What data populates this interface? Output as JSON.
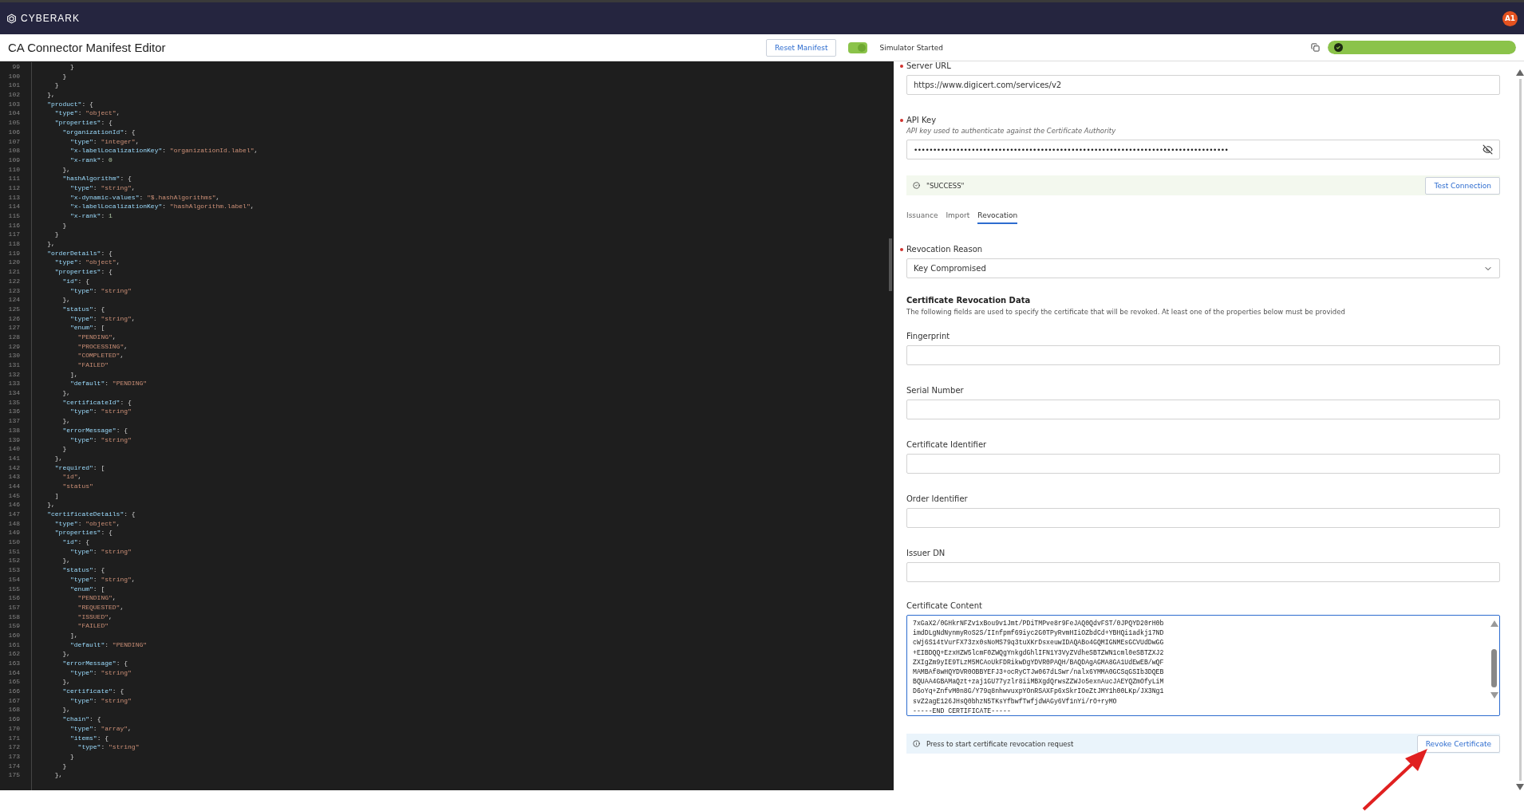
{
  "top_bar": {
    "brand": "CYBERARK",
    "avatar": "A1"
  },
  "header": {
    "title": "CA Connector Manifest Editor",
    "reset_button": "Reset Manifest",
    "simulator": {
      "on": true,
      "label": "Simulator Started"
    },
    "status_bar": {
      "level": 1
    }
  },
  "editor": {
    "lines": [
      {
        "num": "99",
        "text": "          }"
      },
      {
        "num": "100",
        "text": "        }"
      },
      {
        "num": "101",
        "text": "      }"
      },
      {
        "num": "102",
        "text": "    },"
      },
      {
        "num": "103",
        "text": "    \"product\": {"
      },
      {
        "num": "104",
        "text": "      \"type\": \"object\","
      },
      {
        "num": "105",
        "text": "      \"properties\": {"
      },
      {
        "num": "106",
        "text": "        \"organizationId\": {"
      },
      {
        "num": "107",
        "text": "          \"type\": \"integer\","
      },
      {
        "num": "108",
        "text": "          \"x-labelLocalizationKey\": \"organizationId.label\","
      },
      {
        "num": "109",
        "text": "          \"x-rank\": 0"
      },
      {
        "num": "110",
        "text": "        },"
      },
      {
        "num": "111",
        "text": "        \"hashAlgorithm\": {"
      },
      {
        "num": "112",
        "text": "          \"type\": \"string\","
      },
      {
        "num": "113",
        "text": "          \"x-dynamic-values\": \"$.hashAlgorithms\","
      },
      {
        "num": "114",
        "text": "          \"x-labelLocalizationKey\": \"hashAlgorithm.label\","
      },
      {
        "num": "115",
        "text": "          \"x-rank\": 1"
      },
      {
        "num": "116",
        "text": "        }"
      },
      {
        "num": "117",
        "text": "      }"
      },
      {
        "num": "118",
        "text": "    },"
      },
      {
        "num": "119",
        "text": "    \"orderDetails\": {"
      },
      {
        "num": "120",
        "text": "      \"type\": \"object\","
      },
      {
        "num": "121",
        "text": "      \"properties\": {"
      },
      {
        "num": "122",
        "text": "        \"id\": {"
      },
      {
        "num": "123",
        "text": "          \"type\": \"string\""
      },
      {
        "num": "124",
        "text": "        },"
      },
      {
        "num": "125",
        "text": "        \"status\": {"
      },
      {
        "num": "126",
        "text": "          \"type\": \"string\","
      },
      {
        "num": "127",
        "text": "          \"enum\": ["
      },
      {
        "num": "128",
        "text": "            \"PENDING\","
      },
      {
        "num": "129",
        "text": "            \"PROCESSING\","
      },
      {
        "num": "130",
        "text": "            \"COMPLETED\","
      },
      {
        "num": "131",
        "text": "            \"FAILED\""
      },
      {
        "num": "132",
        "text": "          ],"
      },
      {
        "num": "133",
        "text": "          \"default\": \"PENDING\""
      },
      {
        "num": "134",
        "text": "        },"
      },
      {
        "num": "135",
        "text": "        \"certificateId\": {"
      },
      {
        "num": "136",
        "text": "          \"type\": \"string\""
      },
      {
        "num": "137",
        "text": "        },"
      },
      {
        "num": "138",
        "text": "        \"errorMessage\": {"
      },
      {
        "num": "139",
        "text": "          \"type\": \"string\""
      },
      {
        "num": "140",
        "text": "        }"
      },
      {
        "num": "141",
        "text": "      },"
      },
      {
        "num": "142",
        "text": "      \"required\": ["
      },
      {
        "num": "143",
        "text": "        \"id\","
      },
      {
        "num": "144",
        "text": "        \"status\""
      },
      {
        "num": "145",
        "text": "      ]"
      },
      {
        "num": "146",
        "text": "    },"
      },
      {
        "num": "147",
        "text": "    \"certificateDetails\": {"
      },
      {
        "num": "148",
        "text": "      \"type\": \"object\","
      },
      {
        "num": "149",
        "text": "      \"properties\": {"
      },
      {
        "num": "150",
        "text": "        \"id\": {"
      },
      {
        "num": "151",
        "text": "          \"type\": \"string\""
      },
      {
        "num": "152",
        "text": "        },"
      },
      {
        "num": "153",
        "text": "        \"status\": {"
      },
      {
        "num": "154",
        "text": "          \"type\": \"string\","
      },
      {
        "num": "155",
        "text": "          \"enum\": ["
      },
      {
        "num": "156",
        "text": "            \"PENDING\","
      },
      {
        "num": "157",
        "text": "            \"REQUESTED\","
      },
      {
        "num": "158",
        "text": "            \"ISSUED\","
      },
      {
        "num": "159",
        "text": "            \"FAILED\""
      },
      {
        "num": "160",
        "text": "          ],"
      },
      {
        "num": "161",
        "text": "          \"default\": \"PENDING\""
      },
      {
        "num": "162",
        "text": "        },"
      },
      {
        "num": "163",
        "text": "        \"errorMessage\": {"
      },
      {
        "num": "164",
        "text": "          \"type\": \"string\""
      },
      {
        "num": "165",
        "text": "        },"
      },
      {
        "num": "166",
        "text": "        \"certificate\": {"
      },
      {
        "num": "167",
        "text": "          \"type\": \"string\""
      },
      {
        "num": "168",
        "text": "        },"
      },
      {
        "num": "169",
        "text": "        \"chain\": {"
      },
      {
        "num": "170",
        "text": "          \"type\": \"array\","
      },
      {
        "num": "171",
        "text": "          \"items\": {"
      },
      {
        "num": "172",
        "text": "            \"type\": \"string\""
      },
      {
        "num": "173",
        "text": "          }"
      },
      {
        "num": "174",
        "text": "        }"
      },
      {
        "num": "175",
        "text": "      },"
      }
    ]
  },
  "form": {
    "server_url": {
      "label": "Server URL",
      "required": true,
      "value": "https://www.digicert.com/services/v2"
    },
    "api_key": {
      "label": "API Key",
      "required": true,
      "hint": "API key used to authenticate against the Certificate Authority",
      "value": "••••••••••••••••••••••••••••••••••••••••••••••••••••••••••••••••••••••••••••••••••"
    },
    "connection": {
      "message": "\"SUCCESS\"",
      "button": "Test Connection"
    },
    "tabs": [
      {
        "label": "Issuance",
        "selected": false
      },
      {
        "label": "Import",
        "selected": false
      },
      {
        "label": "Revocation",
        "selected": true
      }
    ],
    "revocation_reason": {
      "label": "Revocation Reason",
      "required": true,
      "value": "Key Compromised"
    },
    "section": {
      "title": "Certificate Revocation Data",
      "description": "The following fields are used to specify the certificate that will be revoked. At least one of the properties below must be provided"
    },
    "fields": [
      {
        "label": "Fingerprint",
        "required": false
      },
      {
        "label": "Serial Number",
        "required": false
      },
      {
        "label": "Certificate Identifier",
        "required": false
      },
      {
        "label": "Order Identifier",
        "required": false
      },
      {
        "label": "Issuer DN",
        "required": false
      }
    ],
    "certificate_content": {
      "label": "Certificate Content",
      "lines": [
        "7xGaX2/0GHkrNFZv1xBou9v1Jmt/PDiTMPve8r9FeJAQ0QdvFST/0JPQYD20rH0b",
        "imdDLgNdNynmyRoS2S/IInfpmf69iyc2G0TPyRvmHIiOZbdCd+YBHQi1adkj17ND",
        "cWj6S14tVurFX73zx0sNoMS79q3tuXKrDsxeuwIDAQABo4GQMIGNMEsGCVUdDwGG",
        "+EIBDQQ+EzxHZW5lcmF0ZWQgYnkgdGhlIFN1Y3VyZVdheSBTZWN1cml0eSBTZXJ2",
        "ZXIgZm9yIE9TLzM5MCAoUkFDRikwDgYDVR0PAQH/BAQDAgAGMA8GA1UdEwEB/wQF",
        "MAMBAf8wHQYDVR0OBBYEFJ3+ocRyCTJw067dLSwr/nalx6YMMA0GCSqGSIb3DQEB",
        "BQUAA4GBAMaQzt+zaj1GU77yzlr8iiMBXgdQrwsZZWJo5exnAucJAEYQZmOfyLiM",
        "D6oYq+ZnfvM0n8G/Y79q8nhwvuxpYOnRSAXFp6xSkrIOeZtJMY1h00LKp/JX3Ng1",
        "svZ2agE126JHsQ0bhzN5TKsYfbwfTwfjdWAGy6Vf1nYi/rO+ryMO",
        "-----END CERTIFICATE-----"
      ]
    },
    "action": {
      "message": "Press to start certificate revocation request",
      "button": "Revoke Certificate"
    }
  }
}
